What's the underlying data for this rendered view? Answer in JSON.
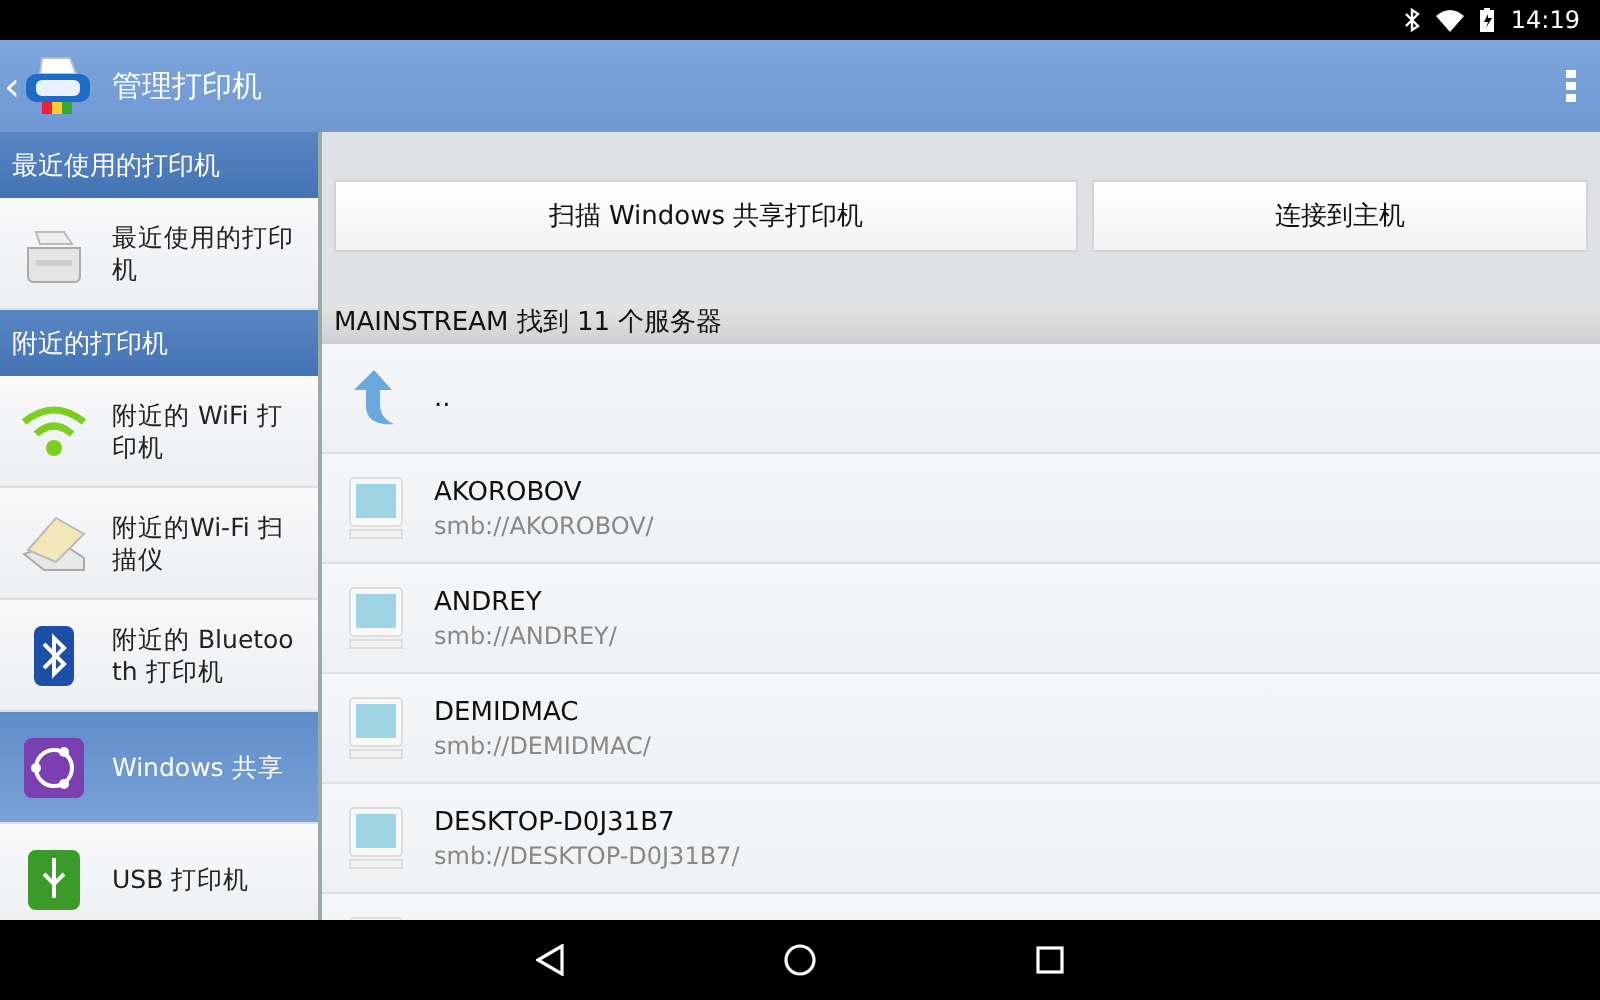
{
  "status_bar": {
    "time": "14:19"
  },
  "app_bar": {
    "title": "管理打印机",
    "back": "‹"
  },
  "sidebar": {
    "sections": [
      {
        "header": "最近使用的打印机",
        "items": [
          {
            "label": "最近使用的打印机",
            "selected": false
          }
        ]
      },
      {
        "header": "附近的打印机",
        "items": [
          {
            "label": "附近的 WiFi 打印机",
            "selected": false
          },
          {
            "label": "附近的Wi-Fi 扫描仪",
            "selected": false
          },
          {
            "label": "附近的 Bluetooth 打印机",
            "selected": false
          },
          {
            "label": "Windows 共享",
            "selected": true
          },
          {
            "label": "USB 打印机",
            "selected": false
          }
        ]
      }
    ]
  },
  "buttons": [
    "扫描 Windows 共享打印机",
    "连接到主机"
  ],
  "server_list": {
    "header": "MAINSTREAM 找到 11 个服务器",
    "rows": [
      {
        "kind": "parent",
        "name": ".."
      },
      {
        "kind": "server",
        "name": "AKOROBOV",
        "path": "smb://AKOROBOV/"
      },
      {
        "kind": "server",
        "name": "ANDREY",
        "path": "smb://ANDREY/"
      },
      {
        "kind": "server",
        "name": "DEMIDMAC",
        "path": "smb://DEMIDMAC/"
      },
      {
        "kind": "server",
        "name": "DESKTOP-D0J31B7",
        "path": "smb://DESKTOP-D0J31B7/"
      },
      {
        "kind": "server"
      }
    ]
  }
}
